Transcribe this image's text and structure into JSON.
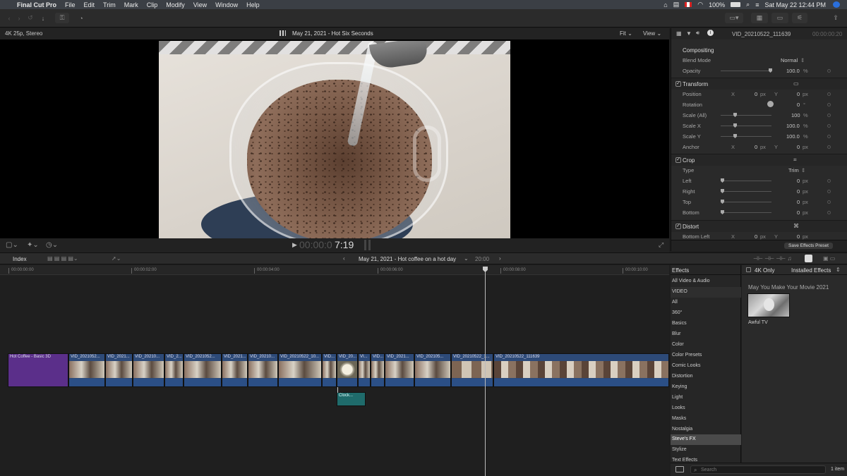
{
  "menubar": {
    "app_name": "Final Cut Pro",
    "items": [
      "File",
      "Edit",
      "Trim",
      "Mark",
      "Clip",
      "Modify",
      "View",
      "Window",
      "Help"
    ],
    "battery": "100%",
    "datetime": "Sat May 22  12:44 PM"
  },
  "viewer": {
    "format": "4K 25p, Stereo",
    "title": "May 21, 2021 - Hot Six Seconds",
    "fit_label": "Fit",
    "view_label": "View",
    "timecode_dim": "00:00:0",
    "timecode_bright": "7:19"
  },
  "inspector": {
    "clip_name": "VID_20210522_111639",
    "clip_duration": "00:00:00:20",
    "compositing": {
      "header": "Compositing",
      "blend_mode_label": "Blend Mode",
      "blend_mode_value": "Normal",
      "opacity_label": "Opacity",
      "opacity_value": "100.0",
      "opacity_unit": "%"
    },
    "transform": {
      "header": "Transform",
      "position_label": "Position",
      "rotation_label": "Rotation",
      "rotation_value": "0",
      "rotation_unit": "°",
      "scale_all_label": "Scale (All)",
      "scale_all_value": "100",
      "scale_x_label": "Scale X",
      "scale_x_value": "100.0",
      "scale_y_label": "Scale Y",
      "scale_y_value": "100.0",
      "anchor_label": "Anchor",
      "x_label": "X",
      "y_label": "Y",
      "zero": "0",
      "px": "px",
      "pct": "%"
    },
    "crop": {
      "header": "Crop",
      "type_label": "Type",
      "type_value": "Trim",
      "left_label": "Left",
      "right_label": "Right",
      "top_label": "Top",
      "bottom_label": "Bottom"
    },
    "distort": {
      "header": "Distort",
      "bottom_left_label": "Bottom Left"
    },
    "save_preset_label": "Save Effects Preset"
  },
  "timeline_bar": {
    "index_label": "Index",
    "project_title": "May 21, 2021 - Hot coffee on a hot day",
    "duration": "20:00"
  },
  "ruler": [
    "00:00:00:00",
    "00:00:02:00",
    "00:00:04:00",
    "00:00:06:00",
    "00:00:08:00",
    "00:00:10:00"
  ],
  "clips": [
    {
      "name": "Hot Coffee - Basic 3D"
    },
    {
      "name": "VID_2021052..."
    },
    {
      "name": "VID_2021..."
    },
    {
      "name": "VID_20210..."
    },
    {
      "name": "VID_2..."
    },
    {
      "name": "VID_2021052..."
    },
    {
      "name": "VID_2021..."
    },
    {
      "name": "VID_20210..."
    },
    {
      "name": "VID_20210522_10..."
    },
    {
      "name": "VID..."
    },
    {
      "name": "VID_20..."
    },
    {
      "name": "VI..."
    },
    {
      "name": "VID..."
    },
    {
      "name": "VID_2021..."
    },
    {
      "name": "VID_202105..."
    },
    {
      "name": "VID_20210522_1..."
    },
    {
      "name": "VID_20210522_111639"
    }
  ],
  "connected_clip": "Clock...",
  "effects": {
    "header": "Effects",
    "four_k_only": "4K Only",
    "installed_effects": "Installed Effects",
    "categories": [
      "All Video & Audio",
      "VIDEO",
      "All",
      "360°",
      "Basics",
      "Blur",
      "Color",
      "Color Presets",
      "Comic Looks",
      "Distortion",
      "Keying",
      "Light",
      "Looks",
      "Masks",
      "Nostalgia",
      "Steve's FX",
      "Stylize",
      "Text Effects"
    ],
    "selected_category": "Steve's FX",
    "group_title": "May You Make Your Movie 2021",
    "item_name": "Awful TV",
    "search_placeholder": "Search",
    "item_count": "1 item"
  },
  "colors": {
    "clip_blue": "#2d4a78",
    "title_purple": "#5b2f8a",
    "connected_teal": "#1f6b6b",
    "menubar": "#3b3f45"
  }
}
